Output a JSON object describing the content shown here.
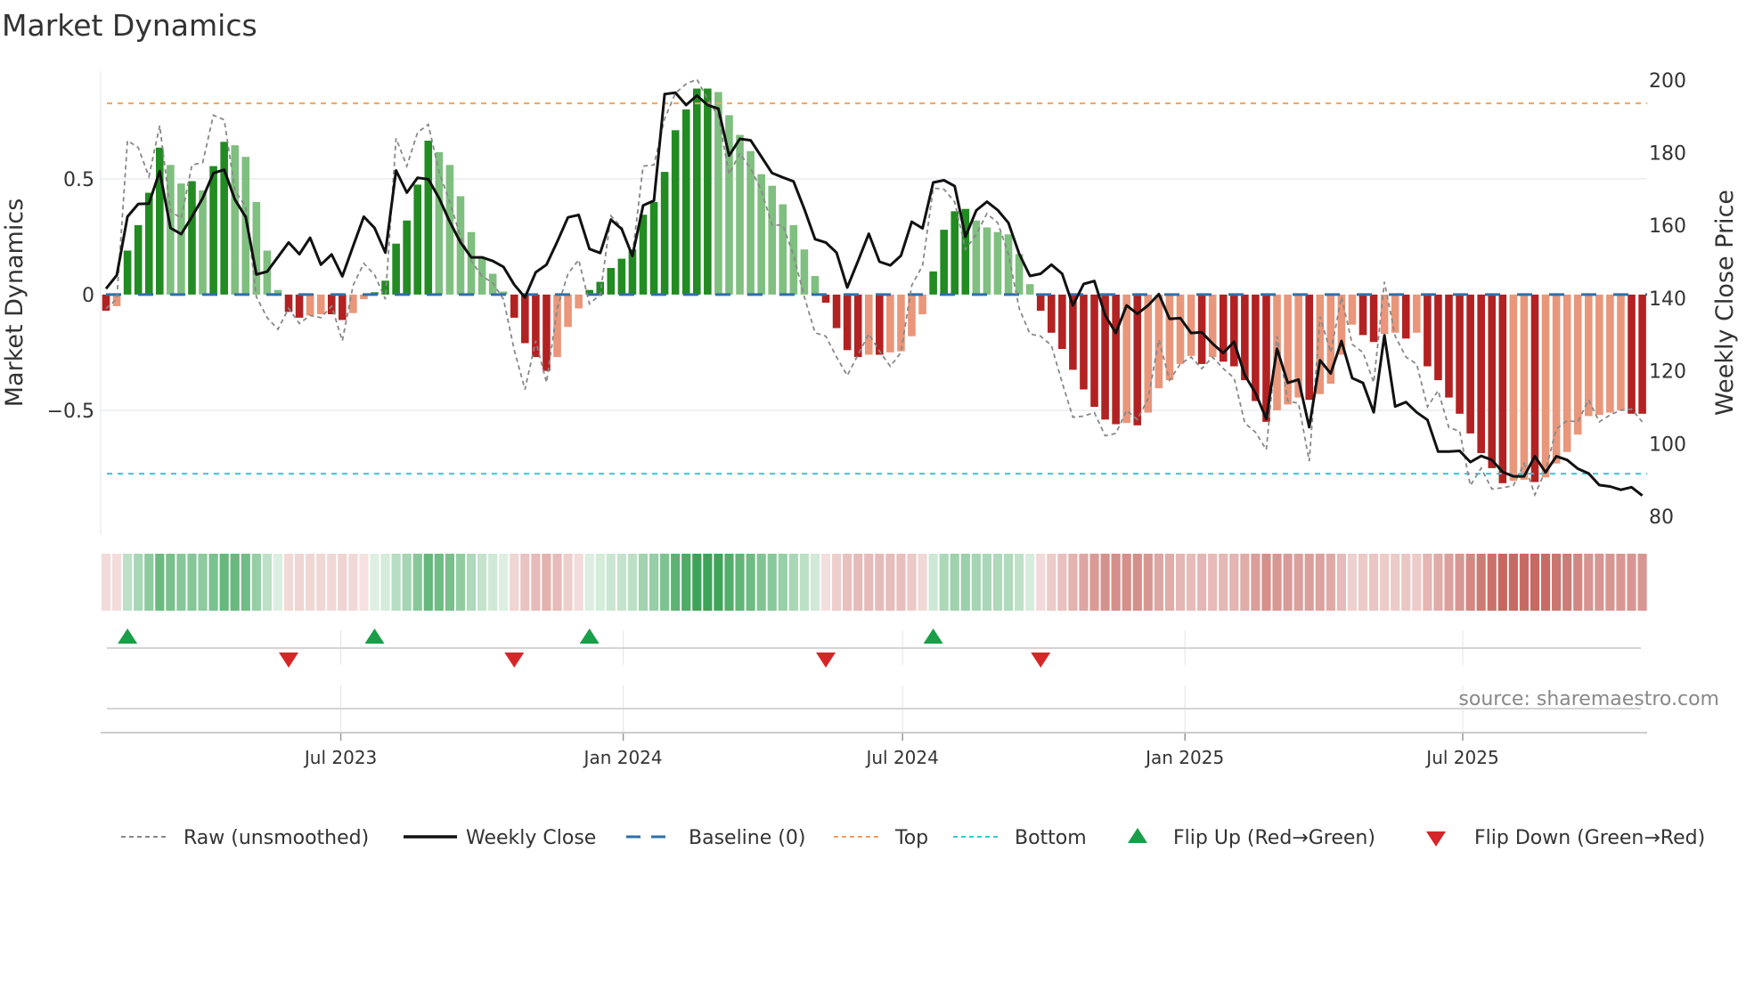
{
  "title": "Market Dynamics",
  "source": "source: sharemaestro.com",
  "colors": {
    "bar_up_strong": "#228b22",
    "bar_up_weak": "#7fbf7f",
    "bar_down_strong": "#b22222",
    "bar_down_weak": "#e9967a",
    "heat_up": "#3aa357",
    "heat_down": "#c25a54",
    "raw_line": "#888888",
    "close_line": "#111111",
    "baseline": "#2f6fa8",
    "top": "#f0a25e",
    "bottom": "#3cc6d8",
    "flip_up": "#1a9e48",
    "flip_down": "#d62728"
  },
  "legend": [
    {
      "label": "Raw (unsmoothed)",
      "icon": "dotted-line"
    },
    {
      "label": "Weekly Close",
      "icon": "solid-line"
    },
    {
      "label": "Baseline (0)",
      "icon": "dashed-line"
    },
    {
      "label": "Top",
      "icon": "dotted-line"
    },
    {
      "label": "Bottom",
      "icon": "dotted-line"
    },
    {
      "label": "Flip Up (Red→Green)",
      "icon": "triangle-up"
    },
    {
      "label": "Flip Down (Green→Red)",
      "icon": "triangle-down"
    }
  ],
  "chart_data": {
    "type": "bar",
    "title": "Market Dynamics",
    "ylabel": "Market Dynamics",
    "ylabel_right": "Weekly Close Price",
    "start_date": "2023-01-29",
    "frequency": "weekly",
    "ylim": [
      -1.035,
      0.965
    ],
    "ylim_right": [
      75.1,
      202.4
    ],
    "grid": true,
    "legend_position": "bottom",
    "yticks": [
      {
        "value": 0.5,
        "label": "0.5"
      },
      {
        "value": 0,
        "label": "0"
      },
      {
        "value": -0.5,
        "label": "−0.5"
      }
    ],
    "yticks_right": [
      {
        "value": 200,
        "label": "200"
      },
      {
        "value": 180,
        "label": "180"
      },
      {
        "value": 160,
        "label": "160"
      },
      {
        "value": 140,
        "label": "140"
      },
      {
        "value": 120,
        "label": "120"
      },
      {
        "value": 100,
        "label": "100"
      },
      {
        "value": 80,
        "label": "80"
      }
    ],
    "xticks": [
      {
        "date": "2023-07-01",
        "label": "Jul 2023"
      },
      {
        "date": "2024-01-01",
        "label": "Jan 2024"
      },
      {
        "date": "2024-07-01",
        "label": "Jul 2024"
      },
      {
        "date": "2025-01-01",
        "label": "Jan 2025"
      },
      {
        "date": "2025-07-01",
        "label": "Jul 2025"
      }
    ],
    "top_level": 0.826,
    "bottom_level": -0.774,
    "baseline": 0,
    "series": [
      {
        "name": "Smoothed",
        "values": [
          -0.07,
          -0.05,
          0.19,
          0.3,
          0.44,
          0.635,
          0.56,
          0.48,
          0.49,
          0.45,
          0.555,
          0.66,
          0.645,
          0.595,
          0.4,
          0.19,
          0.02,
          -0.075,
          -0.1,
          -0.09,
          -0.085,
          -0.085,
          -0.11,
          -0.08,
          -0.02,
          0.01,
          0.06,
          0.22,
          0.32,
          0.475,
          0.665,
          0.615,
          0.56,
          0.425,
          0.27,
          0.155,
          0.09,
          0.013,
          -0.1,
          -0.21,
          -0.27,
          -0.33,
          -0.27,
          -0.14,
          -0.06,
          0.02,
          0.055,
          0.115,
          0.155,
          0.195,
          0.345,
          0.4,
          0.53,
          0.71,
          0.8,
          0.89,
          0.89,
          0.875,
          0.775,
          0.69,
          0.62,
          0.52,
          0.47,
          0.39,
          0.3,
          0.195,
          0.08,
          -0.035,
          -0.145,
          -0.24,
          -0.27,
          -0.26,
          -0.26,
          -0.25,
          -0.245,
          -0.18,
          -0.085,
          0.1,
          0.28,
          0.36,
          0.37,
          0.32,
          0.29,
          0.27,
          0.26,
          0.175,
          0.045,
          -0.07,
          -0.165,
          -0.235,
          -0.325,
          -0.41,
          -0.485,
          -0.54,
          -0.56,
          -0.555,
          -0.565,
          -0.51,
          -0.405,
          -0.37,
          -0.3,
          -0.265,
          -0.3,
          -0.27,
          -0.29,
          -0.31,
          -0.37,
          -0.46,
          -0.55,
          -0.5,
          -0.475,
          -0.445,
          -0.455,
          -0.43,
          -0.385,
          -0.26,
          -0.13,
          -0.175,
          -0.205,
          -0.17,
          -0.165,
          -0.19,
          -0.165,
          -0.31,
          -0.37,
          -0.445,
          -0.515,
          -0.6,
          -0.685,
          -0.75,
          -0.815,
          -0.805,
          -0.8,
          -0.81,
          -0.79,
          -0.73,
          -0.68,
          -0.605,
          -0.525,
          -0.52,
          -0.51,
          -0.5,
          -0.515,
          -0.515
        ]
      },
      {
        "name": "Raw (unsmoothed)",
        "values": [
          -0.06,
          -0.02,
          0.665,
          0.635,
          0.51,
          0.73,
          0.36,
          0.33,
          0.56,
          0.57,
          0.775,
          0.755,
          0.45,
          0.38,
          -0.01,
          -0.1,
          -0.15,
          -0.06,
          -0.125,
          -0.09,
          -0.1,
          -0.05,
          -0.2,
          0.04,
          0.135,
          0.085,
          -0.02,
          0.675,
          0.555,
          0.7,
          0.735,
          0.53,
          0.4,
          0.25,
          0.145,
          0.08,
          0.05,
          -0.02,
          -0.24,
          -0.41,
          -0.2,
          -0.38,
          -0.06,
          0.09,
          0.15,
          -0.04,
          0.0,
          0.34,
          0.29,
          0.17,
          0.555,
          0.56,
          0.76,
          0.87,
          0.91,
          0.93,
          0.845,
          0.77,
          0.52,
          0.61,
          0.545,
          0.45,
          0.3,
          0.3,
          0.17,
          -0.01,
          -0.165,
          -0.18,
          -0.27,
          -0.35,
          -0.26,
          -0.17,
          -0.245,
          -0.31,
          -0.25,
          0.04,
          0.125,
          0.46,
          0.455,
          0.4,
          0.195,
          0.26,
          0.35,
          0.31,
          0.175,
          -0.06,
          -0.17,
          -0.18,
          -0.22,
          -0.38,
          -0.53,
          -0.525,
          -0.51,
          -0.61,
          -0.6,
          -0.5,
          -0.54,
          -0.45,
          -0.195,
          -0.37,
          -0.3,
          -0.27,
          -0.32,
          -0.27,
          -0.32,
          -0.36,
          -0.555,
          -0.595,
          -0.67,
          -0.18,
          -0.46,
          -0.47,
          -0.72,
          -0.095,
          -0.25,
          -0.01,
          -0.215,
          -0.25,
          -0.38,
          0.055,
          -0.18,
          -0.27,
          -0.3,
          -0.485,
          -0.415,
          -0.575,
          -0.59,
          -0.825,
          -0.75,
          -0.84,
          -0.835,
          -0.825,
          -0.73,
          -0.865,
          -0.76,
          -0.58,
          -0.545,
          -0.55,
          -0.455,
          -0.55,
          -0.52,
          -0.5,
          -0.495,
          -0.55
        ]
      },
      {
        "name": "Weekly Close",
        "axis": "right",
        "values": [
          142.6,
          146.3,
          162.4,
          165.9,
          166.0,
          174.9,
          159.3,
          157.6,
          162.4,
          167.5,
          174.4,
          175.3,
          167.1,
          162.3,
          146.5,
          147.3,
          151.3,
          155.3,
          152.1,
          156.6,
          149.2,
          152.0,
          146.0,
          154.3,
          162.4,
          159.3,
          152.5,
          175.1,
          169.0,
          173.1,
          172.7,
          167.5,
          161.0,
          155.3,
          151.2,
          151.2,
          150.2,
          148.6,
          143.7,
          140.2,
          147.1,
          149.2,
          155.5,
          162.2,
          162.9,
          153.5,
          152.4,
          161.6,
          159.0,
          151.6,
          165.5,
          166.8,
          196.1,
          196.5,
          193.1,
          195.7,
          193.1,
          192.1,
          179.2,
          183.8,
          183.4,
          178.9,
          174.4,
          173.2,
          172.1,
          164.5,
          156.2,
          155.3,
          152.5,
          142.9,
          150.2,
          157.7,
          150.0,
          149.0,
          151.7,
          161.0,
          159.2,
          171.8,
          172.4,
          170.8,
          156.9,
          164.1,
          166.5,
          164.2,
          160.7,
          152.2,
          146.1,
          146.7,
          149.2,
          146.7,
          138.0,
          143.9,
          144.7,
          135.3,
          130.4,
          138.0,
          135.7,
          138.0,
          141.1,
          134.3,
          134.5,
          130.4,
          130.6,
          127.5,
          124.9,
          128.0,
          118.8,
          113.9,
          106.8,
          126.1,
          116.7,
          117.6,
          104.5,
          122.9,
          119.3,
          128.2,
          118.0,
          116.7,
          108.6,
          129.8,
          110.2,
          111.4,
          108.6,
          106.5,
          97.8,
          97.8,
          98.0,
          94.9,
          96.6,
          95.5,
          92.2,
          91.0,
          91.0,
          96.5,
          92.1,
          96.5,
          95.5,
          93.1,
          91.8,
          88.6,
          88.2,
          87.3,
          88.0,
          85.7
        ]
      }
    ],
    "flips_up": [
      2,
      25,
      45,
      77
    ],
    "flips_down": [
      17,
      38,
      67,
      87
    ]
  }
}
